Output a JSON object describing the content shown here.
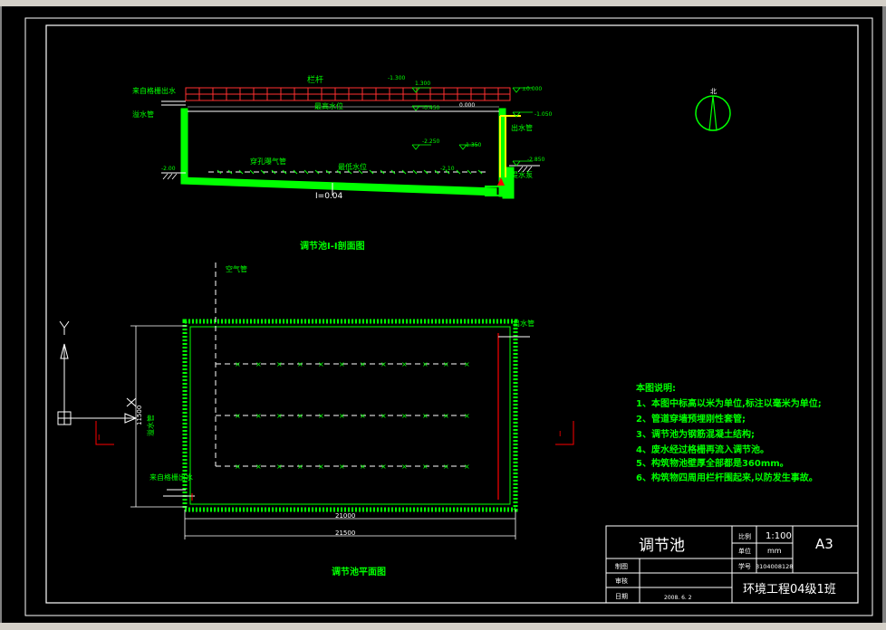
{
  "section": {
    "title": "调节池Ⅰ-Ⅰ剖面图",
    "label_railing": "栏杆",
    "label_inflow": "来自格栅出水",
    "label_overflow": "溢水管",
    "label_max_level": "最高水位",
    "label_min_level": "最低水位",
    "label_aeration": "穿孔曝气管",
    "label_outlet": "出水管",
    "label_pump": "提水泵",
    "slope": "I=0.04",
    "elev_top_left": "1.300",
    "elev_top_right": "±0.000",
    "elev_r1": "-1.050",
    "elev_r2": "-2.850",
    "elev_m1": "-0.450",
    "elev_m2": "-1.350",
    "elev_m3": "-2.250",
    "elev_left": "-2.00",
    "elev_mid": "-2.10",
    "elev_top": "-1.300",
    "elev_small": "0.000"
  },
  "plan": {
    "title": "调节池平面图",
    "label_air": "空气管",
    "label_outlet": "出水管",
    "label_inflow": "来自格栅出水",
    "label_overflow": "溢水管",
    "dim_inner": "21000",
    "dim_outer": "21500",
    "dim_side": "11500",
    "section_mark": "I"
  },
  "axis": {
    "y_label": "Y",
    "x_label": "X"
  },
  "compass": {
    "label": "北"
  },
  "notes": {
    "heading": "本图说明:",
    "items": [
      "1、本图中标高以米为单位,标注以毫米为单位;",
      "2、管道穿墙预埋刚性套管;",
      "3、调节池为钢筋混凝土结构;",
      "4、废水经过格栅再流入调节池。",
      "5、构筑物池壁厚全部都是360mm。",
      "6、构筑物四周用栏杆围起来,以防发生事故。"
    ]
  },
  "title_block": {
    "name": "调节池",
    "scale_label": "比例",
    "scale_value": "1:100",
    "unit_label": "单位",
    "unit_value": "mm",
    "size": "A3",
    "drawn_label": "制图",
    "check_label": "审核",
    "date_label": "日期",
    "date_value": "2008. 6. 2",
    "id_label": "学号",
    "id_value": "3104008128",
    "class": "环境工程04级1班"
  },
  "colors": {
    "line_white": "#ffffff",
    "green": "#00ff00",
    "red": "#ff0000",
    "yellow": "#ffff00",
    "cyan": "#00ffff"
  }
}
